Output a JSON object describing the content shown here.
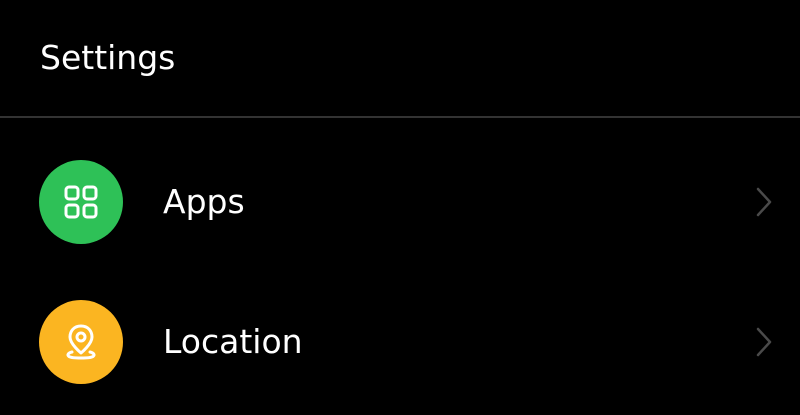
{
  "header": {
    "title": "Settings"
  },
  "items": [
    {
      "label": "Apps",
      "icon": "grid-icon",
      "color": "#2ec157"
    },
    {
      "label": "Location",
      "icon": "location-pin-icon",
      "color": "#fbb521"
    }
  ],
  "colors": {
    "background": "#000000",
    "text": "#ffffff",
    "divider": "#333333",
    "chevron": "#4a4a4a"
  }
}
